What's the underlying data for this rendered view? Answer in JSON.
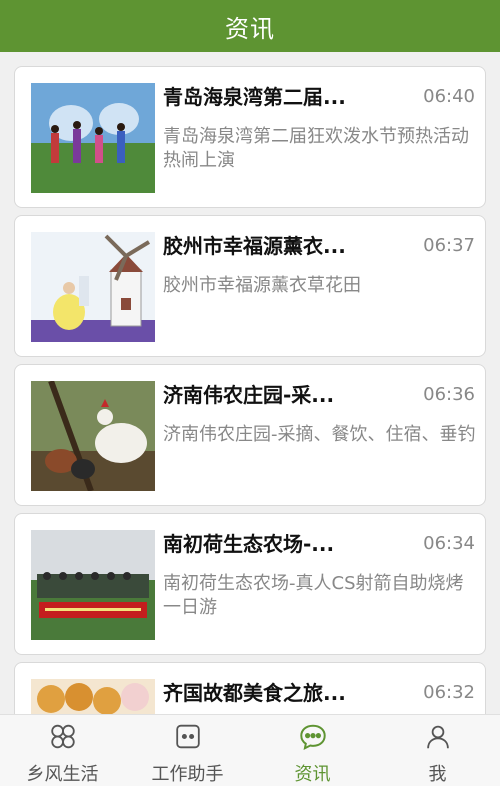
{
  "header": {
    "title": "资讯"
  },
  "news": [
    {
      "title": "青岛海泉湾第二届...",
      "time": "06:40",
      "desc": "青岛海泉湾第二届狂欢泼水节预热活动热闹上演"
    },
    {
      "title": "胶州市幸福源薰衣...",
      "time": "06:37",
      "desc": "胶州市幸福源薰衣草花田"
    },
    {
      "title": "济南伟农庄园-采...",
      "time": "06:36",
      "desc": "济南伟农庄园-采摘、餐饮、住宿、垂钓"
    },
    {
      "title": "南初荷生态农场-...",
      "time": "06:34",
      "desc": "南初荷生态农场-真人CS射箭自助烧烤一日游"
    },
    {
      "title": "齐国故都美食之旅...",
      "time": "06:32",
      "desc": ""
    }
  ],
  "tabbar": {
    "items": [
      {
        "label": "乡风生活",
        "icon": "grid-icon"
      },
      {
        "label": "工作助手",
        "icon": "briefcase-icon"
      },
      {
        "label": "资讯",
        "icon": "chat-bubble-icon",
        "active": true
      },
      {
        "label": "我",
        "icon": "person-icon"
      }
    ]
  },
  "colors": {
    "accent": "#5e9432",
    "background": "#f0f0f0"
  }
}
